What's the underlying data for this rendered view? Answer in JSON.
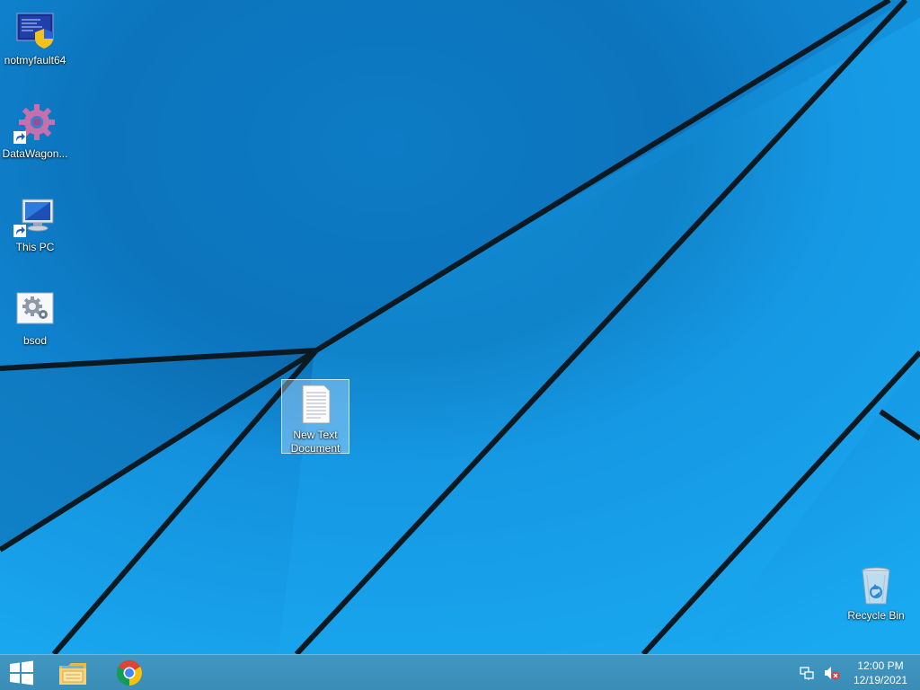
{
  "desktop": {
    "icons": [
      {
        "label": "notmyfault64",
        "icon": "notmyfault-shield-icon"
      },
      {
        "label": "DataWagon...",
        "icon": "gear-shortcut-icon"
      },
      {
        "label": "This PC",
        "icon": "computer-icon"
      },
      {
        "label": "bsod",
        "icon": "settings-file-icon"
      },
      {
        "label": "New Text Document",
        "icon": "text-document-icon",
        "selected": true
      },
      {
        "label": "Recycle Bin",
        "icon": "recycle-bin-icon"
      }
    ]
  },
  "taskbar": {
    "start": "windows-logo-icon",
    "pinned": [
      {
        "name": "File Explorer",
        "icon": "folder-icon"
      },
      {
        "name": "Google Chrome",
        "icon": "chrome-icon"
      }
    ]
  },
  "tray": {
    "icons": [
      "network-icon",
      "speaker-muted-icon"
    ],
    "time": "12:00 PM",
    "date": "12/19/2021"
  },
  "colors": {
    "wallpaper_light": "#14a3ea",
    "wallpaper_dark": "#0a6cb0",
    "taskbar": "#3c90bb"
  }
}
